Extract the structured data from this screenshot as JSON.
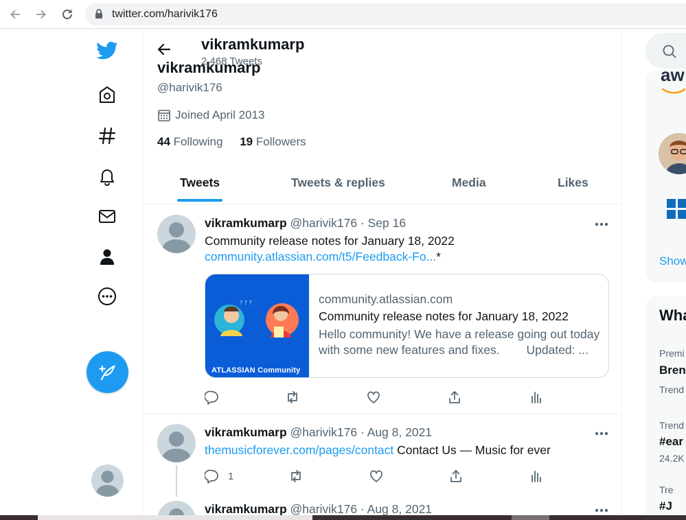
{
  "browser": {
    "url": "twitter.com/harivik176",
    "icons": [
      "back-arrow-icon",
      "forward-arrow-icon",
      "reload-icon",
      "lock-icon"
    ]
  },
  "nav": {
    "icons": [
      "twitter-logo-icon",
      "home-icon",
      "explore-hashtag-icon",
      "notifications-bell-icon",
      "messages-envelope-icon",
      "profile-person-icon",
      "more-dots-icon",
      "compose-tweet-icon"
    ]
  },
  "profile": {
    "name": "vikramkumarp",
    "tweet_count": "2,468 Tweets",
    "handle": "@harivik176",
    "joined": "Joined April 2013",
    "following_count": "44",
    "following_label": "Following",
    "followers_count": "19",
    "followers_label": "Followers"
  },
  "tabs": [
    {
      "label": "Tweets",
      "active": true
    },
    {
      "label": "Tweets & replies"
    },
    {
      "label": "Media"
    },
    {
      "label": "Likes"
    }
  ],
  "tweets": [
    {
      "name": "vikramkumarp",
      "meta": "@harivik176 · Sep 16",
      "text": "Community release notes for January 18, 2022",
      "link": "community.atlassian.com/t5/Feedback-Fo...",
      "link_suffix": "*",
      "card": {
        "brand": "ATLASSIAN Community",
        "domain": "community.atlassian.com",
        "title": "Community release notes for January 18, 2022",
        "desc_line1": "Hello community! We have a release going out today",
        "desc_line2": "with some new features and fixes.        Updated: ..."
      }
    },
    {
      "name": "vikramkumarp",
      "meta": "@harivik176 · Aug 8, 2021",
      "link": "themusicforever.com/pages/contact",
      "text": " Contact Us — Music for ever",
      "reply_count": "1"
    },
    {
      "name": "vikramkumarp",
      "meta": "@harivik176 · Aug 8, 2021"
    }
  ],
  "sidebar": {
    "aws_text": "aw",
    "show_more": "Show",
    "whats_happening": "Wha",
    "trends": [
      {
        "context": "Premi",
        "title": "Bren",
        "sub": "Trend"
      },
      {
        "context": "Trend",
        "title": "#ear",
        "sub": "24.2K"
      },
      {
        "context": "Tre",
        "title": "#J"
      }
    ]
  },
  "colors": {
    "accent": "#1d9bf0",
    "text": "#0f1419",
    "secondary": "#536471",
    "atlassian_blue": "#0b5cd7"
  }
}
